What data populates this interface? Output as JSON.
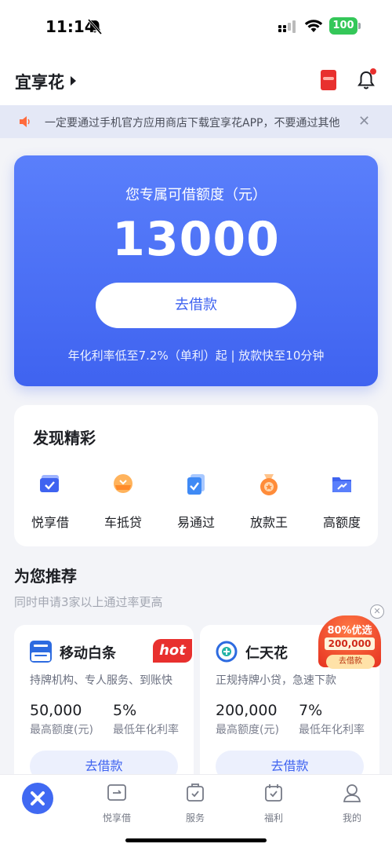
{
  "status_bar": {
    "time": "11:14",
    "battery": "100"
  },
  "header": {
    "brand": "宜享花"
  },
  "notice": {
    "text": "一定要通过手机官方应用商店下载宜享花APP，不要通过其他"
  },
  "hero": {
    "label": "您专属可借额度（元）",
    "amount": "13000",
    "button": "去借款",
    "note": "年化利率低至7.2%（单利）起 | 放款快至10分钟"
  },
  "discover": {
    "title": "发现精彩",
    "items": [
      {
        "label": "悦享借",
        "icon": "card-check-icon",
        "color": "#3f63f0"
      },
      {
        "label": "车抵贷",
        "icon": "car-loan-icon",
        "color": "#ff9a3c"
      },
      {
        "label": "易通过",
        "icon": "doc-check-icon",
        "color": "#3f8af5"
      },
      {
        "label": "放款王",
        "icon": "medal-icon",
        "color": "#ff8c3a"
      },
      {
        "label": "高额度",
        "icon": "folder-up-icon",
        "color": "#3f63f0"
      }
    ]
  },
  "recommend": {
    "title": "为您推荐",
    "subtitle": "同时申请3家以上通过率更高",
    "cards": [
      {
        "logo_text": "移动白条",
        "name": "移动白条",
        "badge": "hot",
        "desc": "持牌机构、专人服务、到账快",
        "amount": "50,000",
        "amount_label": "最高额度(元)",
        "rate": "5%",
        "rate_label": "最低年化利率",
        "button": "去借款"
      },
      {
        "name": "仁天花",
        "desc": "正规持牌小贷，急速下款",
        "amount": "200,000",
        "amount_label": "最高额度(元)",
        "rate": "7%",
        "rate_label": "最低年化利率",
        "button": "去借款"
      }
    ]
  },
  "promo": {
    "percent": "80%优选",
    "amount": "200,000",
    "button": "去借款"
  },
  "tabbar": {
    "items": [
      {
        "label": "悦享借",
        "icon": "loan-icon"
      },
      {
        "label": "服务",
        "icon": "service-icon"
      },
      {
        "label": "福利",
        "icon": "calendar-check-icon"
      },
      {
        "label": "我的",
        "icon": "profile-icon"
      }
    ]
  },
  "colors": {
    "primary": "#3f63f0",
    "danger": "#e8302e",
    "background": "#f3f4f8"
  }
}
